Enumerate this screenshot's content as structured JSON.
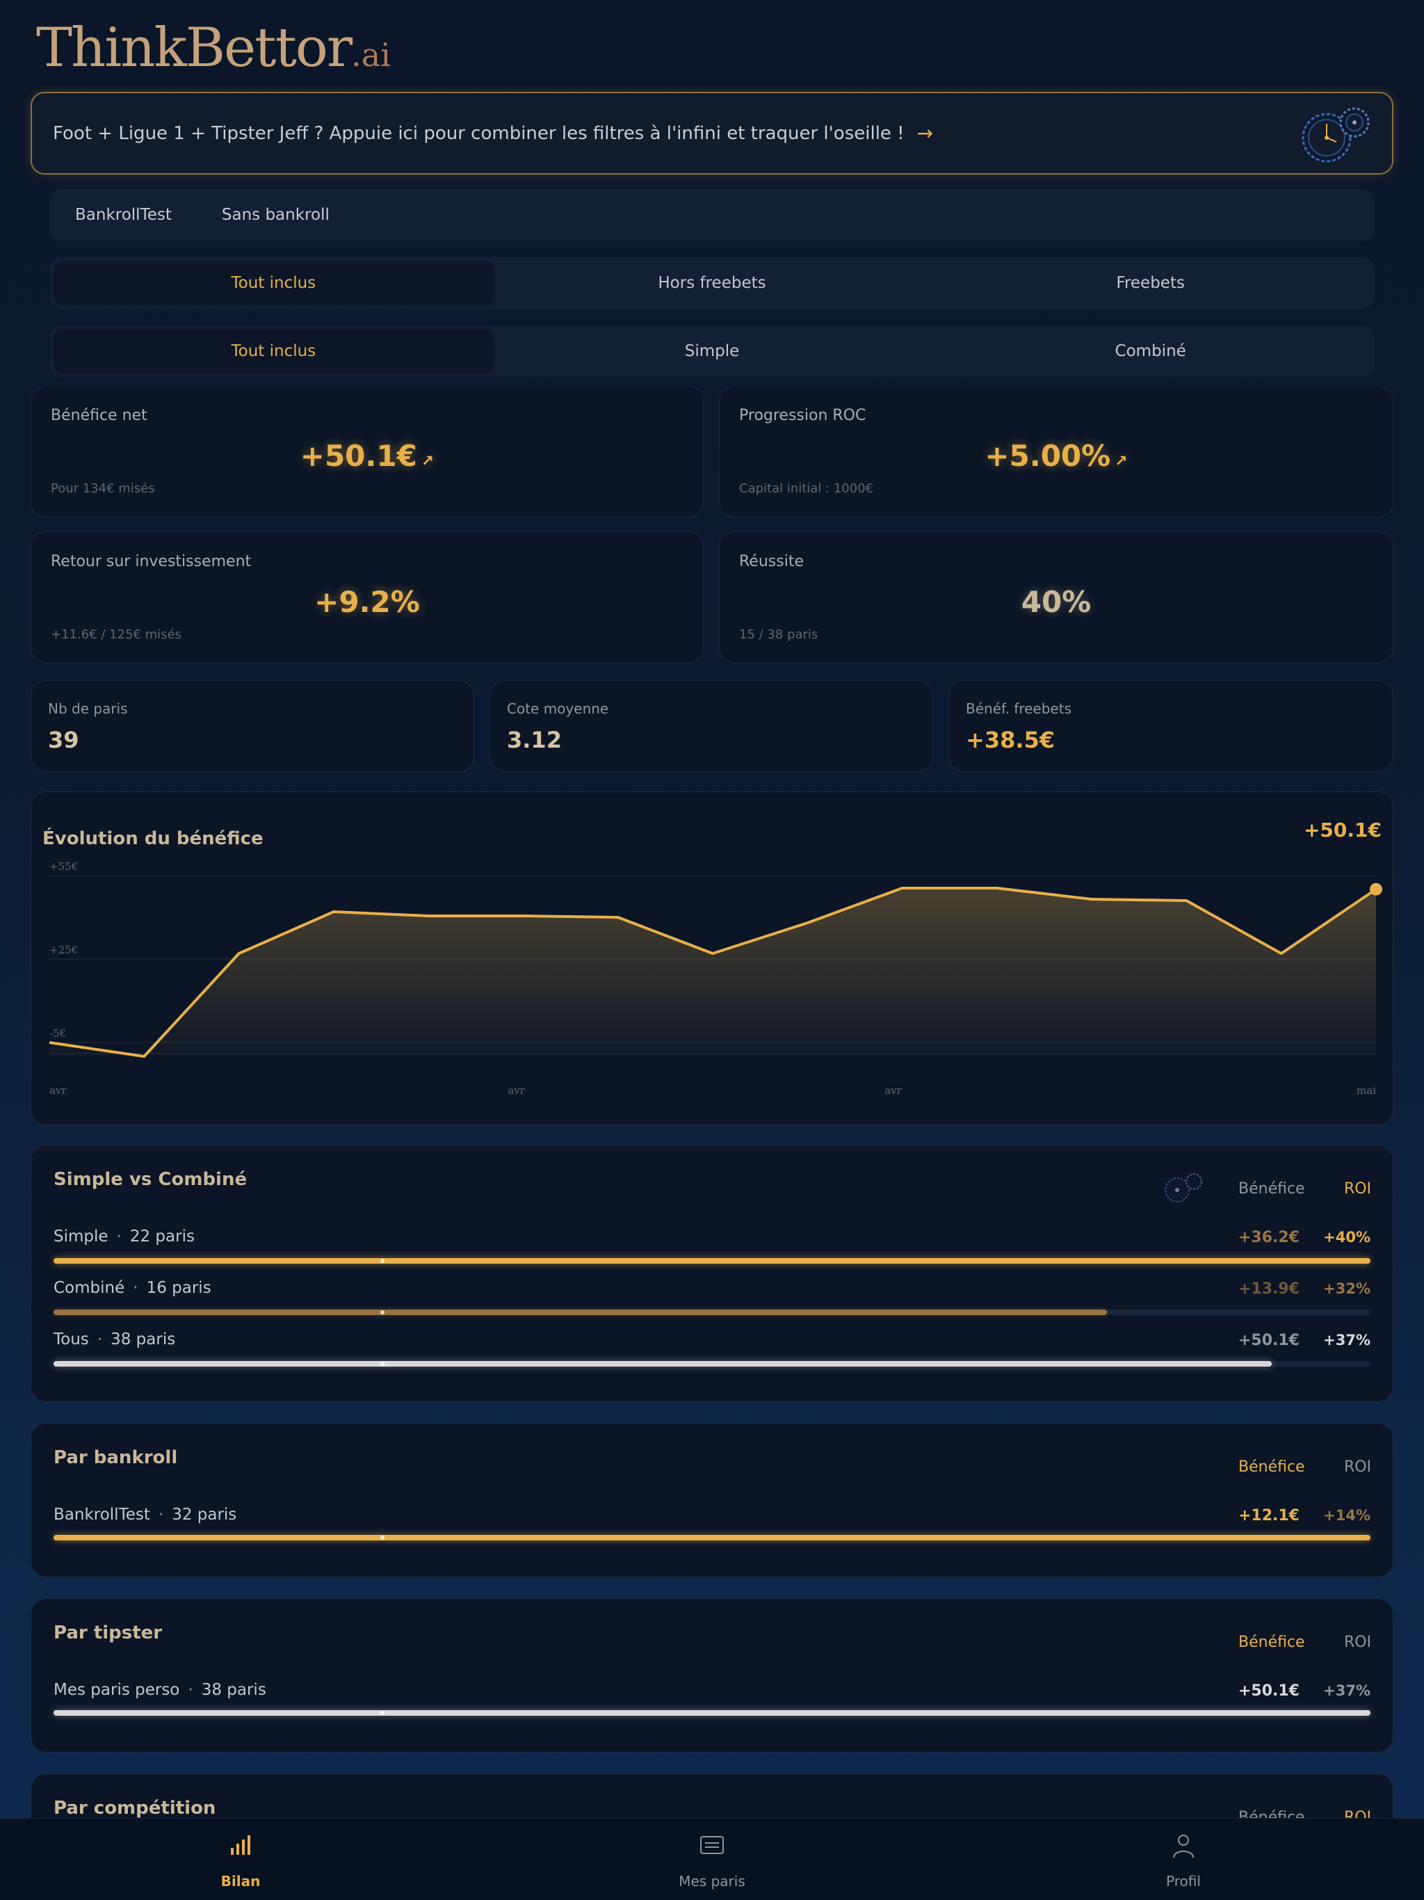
{
  "app": {
    "logo_main": "ThinkBettor",
    "logo_suffix": ".ai"
  },
  "promo": {
    "text": "Foot + Ligue 1 + Tipster Jeff ? Appuie ici pour combiner les filtres à l'infini et traquer l'oseille !",
    "arrow": "→"
  },
  "bankrolls": [
    "BankrollTest",
    "Sans bankroll"
  ],
  "filter_freebets": {
    "options": [
      "Tout inclus",
      "Hors freebets",
      "Freebets"
    ],
    "selected": "Tout inclus"
  },
  "filter_type": {
    "options": [
      "Tout inclus",
      "Simple",
      "Combiné"
    ],
    "selected": "Tout inclus"
  },
  "stats": {
    "benefice_net": {
      "label": "Bénéfice net",
      "value": "+50.1€",
      "trend": "↗",
      "sub": "Pour 134€ misés"
    },
    "progression_roc": {
      "label": "Progression ROC",
      "value": "+5.00%",
      "trend": "↗",
      "sub": "Capital initial : 1000€"
    },
    "roi": {
      "label": "Retour sur investissement",
      "value": "+9.2%",
      "sub": "+11.6€ / 125€ misés"
    },
    "reussite": {
      "label": "Réussite",
      "value": "40%",
      "sub": "15 / 38 paris"
    }
  },
  "mini_stats": {
    "nb_paris": {
      "label": "Nb de paris",
      "value": "39"
    },
    "cote_moyenne": {
      "label": "Cote moyenne",
      "value": "3.12"
    },
    "benef_freebets": {
      "label": "Bénéf. freebets",
      "value": "+38.5€"
    }
  },
  "chart": {
    "title": "Évolution du bénéfice",
    "total": "+50.1€",
    "chart_data": {
      "type": "area",
      "title": "Évolution du bénéfice",
      "y_tick_labels": [
        "+55€",
        "+25€",
        "-5€"
      ],
      "y_ticks": [
        55,
        25,
        -5
      ],
      "ylim": [
        -10,
        55
      ],
      "x_tick_labels": [
        "avr",
        "avr",
        "avr",
        "mai"
      ],
      "values": [
        -5,
        -10,
        27,
        42,
        40.5,
        40.5,
        40,
        27,
        38,
        50.5,
        50.5,
        46.5,
        46,
        27,
        50.1
      ],
      "grid": true,
      "color": "#e8b04a"
    }
  },
  "simple_vs_combine": {
    "title": "Simple vs Combiné",
    "col_benefice": "Bénéfice",
    "col_roi": "ROI",
    "rows": [
      {
        "label": "Simple",
        "count": "22 paris",
        "benefice": "+36.2€",
        "roi": "+40%",
        "fraction": 1.0,
        "color": "#e8b04a"
      },
      {
        "label": "Combiné",
        "count": "16 paris",
        "benefice": "+13.9€",
        "roi": "+32%",
        "fraction": 0.8,
        "color": "#9b7444"
      },
      {
        "label": "Tous",
        "count": "38 paris",
        "benefice": "+50.1€",
        "roi": "+37%",
        "fraction": 0.925,
        "color": "#d9d9db"
      }
    ]
  },
  "par_bankroll": {
    "title": "Par bankroll",
    "col_benefice": "Bénéfice",
    "col_roi": "ROI",
    "rows": [
      {
        "label": "BankrollTest",
        "count": "32 paris",
        "benefice": "+12.1€",
        "roi": "+14%",
        "fraction": 1.0
      }
    ]
  },
  "par_tipster": {
    "title": "Par tipster",
    "col_benefice": "Bénéfice",
    "col_roi": "ROI",
    "rows": [
      {
        "label": "Mes paris perso",
        "count": "38 paris",
        "benefice": "+50.1€",
        "roi": "+37%",
        "fraction": 1.0
      }
    ]
  },
  "par_competition": {
    "title": "Par compétition",
    "col_benefice": "Bénéfice",
    "col_roi": "ROI"
  },
  "nav": {
    "items": [
      "Bilan",
      "Mes paris",
      "Profil"
    ],
    "active": "Bilan"
  },
  "colors": {
    "accent": "#e8b04a",
    "background": "#0b1628",
    "card": "#0b1526"
  }
}
